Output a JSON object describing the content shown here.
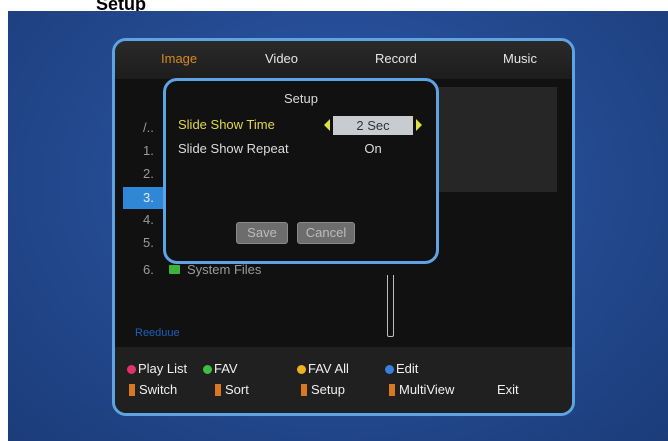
{
  "doc_title": "Setup",
  "tabs": [
    {
      "label": "Image",
      "active": true
    },
    {
      "label": "Video",
      "active": false
    },
    {
      "label": "Record",
      "active": false
    },
    {
      "label": "Music",
      "active": false
    }
  ],
  "file_list": [
    {
      "num": "/..",
      "name": ""
    },
    {
      "num": "1.",
      "name": ""
    },
    {
      "num": "2.",
      "name": ""
    },
    {
      "num": "3.",
      "name": "",
      "selected": true
    },
    {
      "num": "4.",
      "name": ""
    },
    {
      "num": "5.",
      "name": ""
    },
    {
      "num": "6.",
      "name": "System Files",
      "folder": true
    }
  ],
  "path_label": "Reeduue",
  "dialog": {
    "title": "Setup",
    "rows": [
      {
        "label": "Slide Show Time",
        "value": "2 Sec"
      },
      {
        "label": "Slide Show Repeat",
        "value": "On"
      }
    ],
    "save_label": "Save",
    "cancel_label": "Cancel"
  },
  "footer": {
    "row1": [
      {
        "label": "Play List",
        "color": "#e0336c"
      },
      {
        "label": "FAV",
        "color": "#3fbf3f"
      },
      {
        "label": "FAV All",
        "color": "#f0b020"
      },
      {
        "label": "Edit",
        "color": "#3a7ee0"
      }
    ],
    "row2": [
      {
        "label": "Switch",
        "color": "#d87820"
      },
      {
        "label": "Sort",
        "color": "#d87820"
      },
      {
        "label": "Setup",
        "color": "#d87820"
      },
      {
        "label": "MultiView",
        "color": "#d87820"
      },
      {
        "label": "Exit"
      }
    ]
  }
}
